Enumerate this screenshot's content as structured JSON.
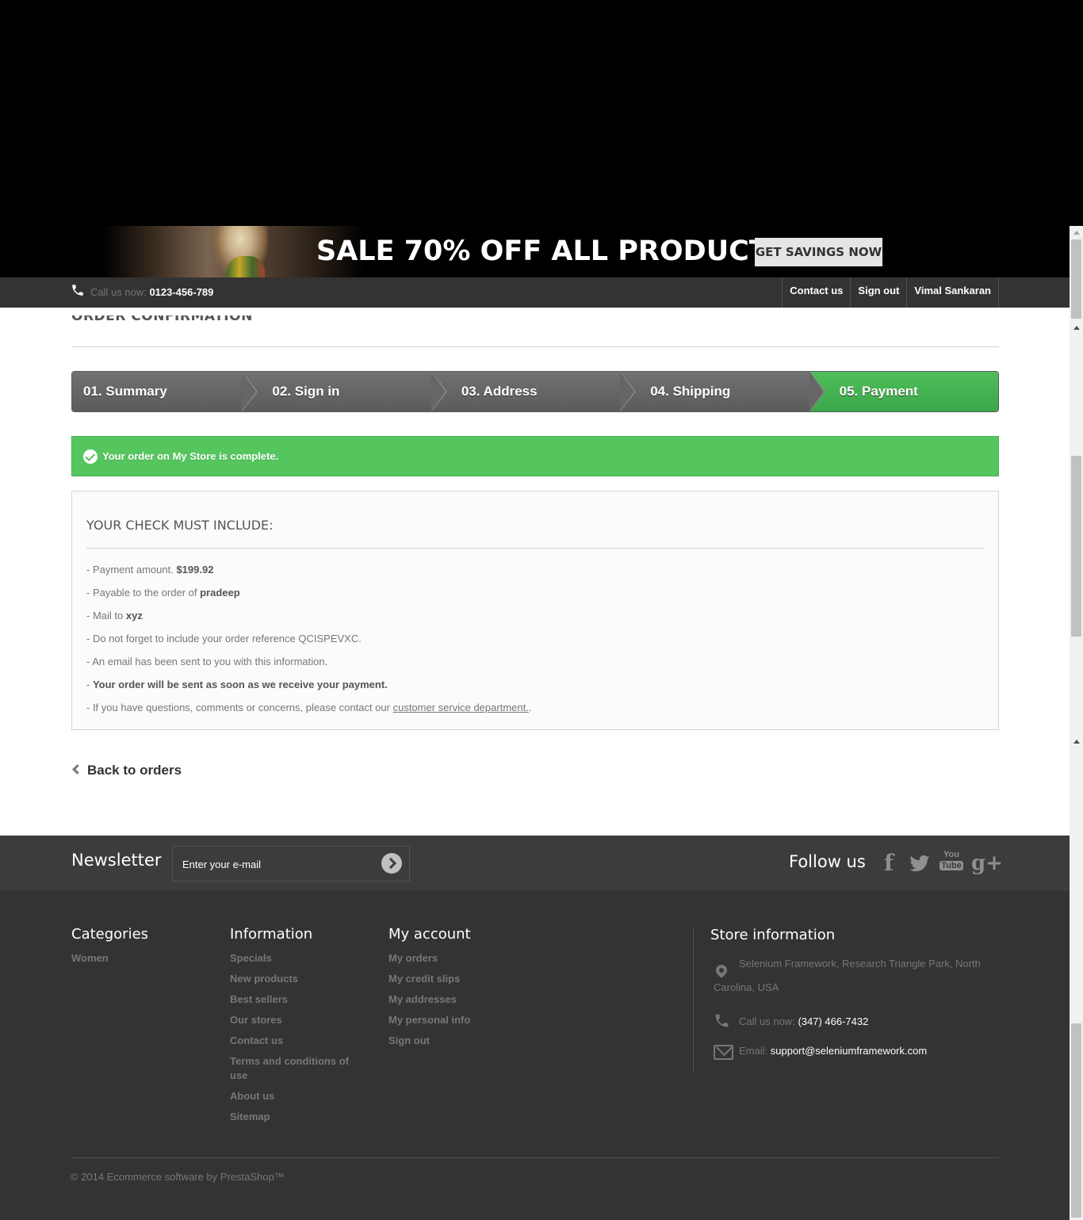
{
  "banner": {
    "headline": "SALE 70% OFF ALL PRODUCTS",
    "button_label": "GET SAVINGS NOW"
  },
  "nav": {
    "call_label": "Call us now:",
    "phone": "0123-456-789",
    "links": [
      "Contact us",
      "Sign out",
      "Vimal Sankaran"
    ],
    "icons": {
      "phone": "phone-icon"
    }
  },
  "page": {
    "heading": "ORDER CONFIRMATION",
    "steps": [
      "01. Summary",
      "02. Sign in",
      "03. Address",
      "04. Shipping",
      "05. Payment"
    ],
    "active_step": 4,
    "alert": "Your order on My Store is complete.",
    "box_title": "YOUR CHECK MUST INCLUDE:",
    "lines": {
      "amount_label": "- Payment amount.",
      "amount_value": "$199.92",
      "payable_label": "- Payable to the order of",
      "payable_value": "pradeep",
      "mail_label": "- Mail to",
      "mail_value": "xyz",
      "reference": "- Do not forget to include your order reference QCISPEVXC.",
      "email_sent": "- An email has been sent to you with this information.",
      "send_prefix": "- ",
      "send_text": "Your order will be sent as soon as we receive your payment.",
      "questions": "- If you have questions, comments or concerns, please contact our ",
      "link": "customer service department.",
      "questions_end": "."
    },
    "back_link": "Back to orders",
    "colors": {
      "success": "#55c65e",
      "step": "#666666"
    }
  },
  "newsletter": {
    "title": "Newsletter",
    "placeholder": "Enter your e-mail",
    "follow_title": "Follow us",
    "social_icons": [
      "facebook-icon",
      "twitter-icon",
      "youtube-icon",
      "google-plus-icon"
    ],
    "youtube_text_1": "You",
    "youtube_text_2": "Tube",
    "facebook_glyph": "f",
    "google_glyph": "g+"
  },
  "footer": {
    "categories_title": "Categories",
    "categories": [
      "Women"
    ],
    "information_title": "Information",
    "information": [
      "Specials",
      "New products",
      "Best sellers",
      "Our stores",
      "Contact us",
      "Terms and conditions of use",
      "About us",
      "Sitemap"
    ],
    "account_title": "My account",
    "account": [
      "My orders",
      "My credit slips",
      "My addresses",
      "My personal info",
      "Sign out"
    ],
    "store_title": "Store information",
    "address_line1": "Selenium Framework, Research Triangle Park, North",
    "address_line2": "Carolina, USA",
    "call_label": "Call us now:",
    "call_value": "(347) 466-7432",
    "email_label": "Email:",
    "email_value": "support@seleniumframework.com",
    "copyright": "© 2014 Ecommerce software by PrestaShop™"
  }
}
